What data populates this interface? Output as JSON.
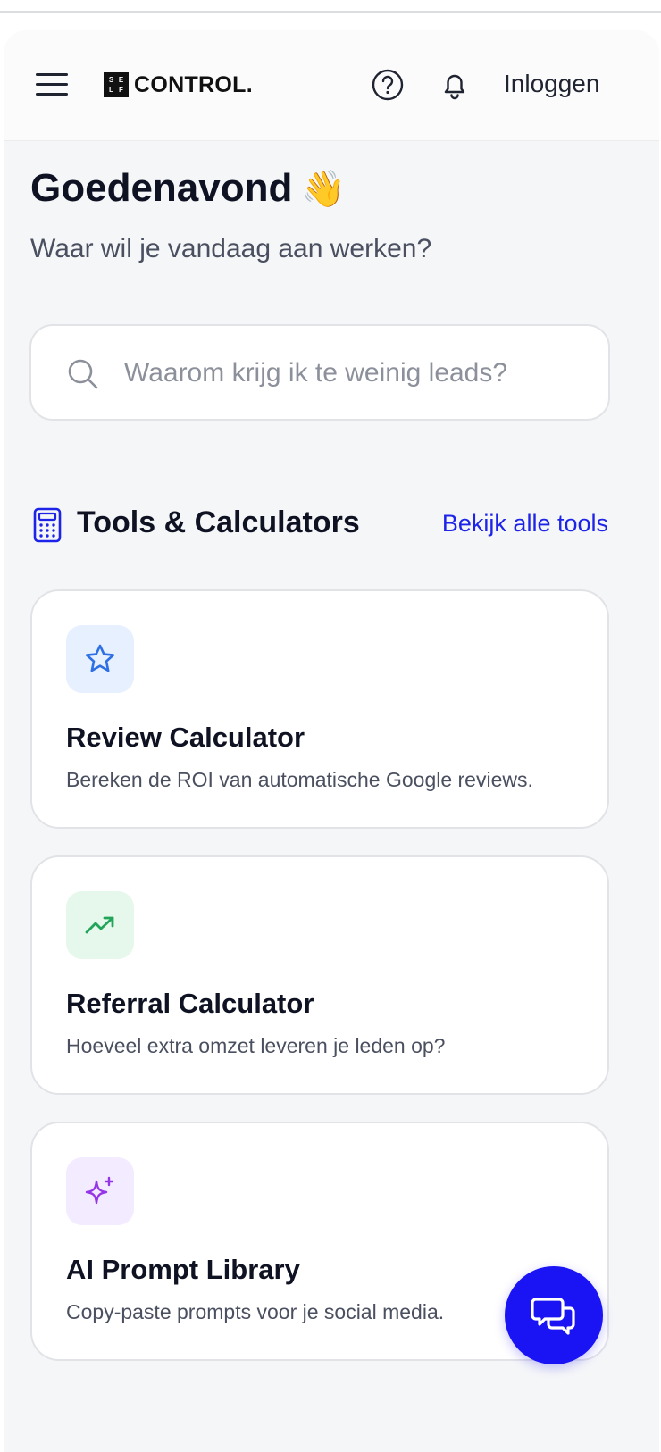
{
  "header": {
    "logo_letters": [
      "S",
      "E",
      "L",
      "F"
    ],
    "logo_text": "CONTROL.",
    "login_label": "Inloggen",
    "icons": [
      "menu-icon",
      "help-icon",
      "bell-icon"
    ]
  },
  "greeting": {
    "title": "Goedenavond",
    "emoji": "👋",
    "subtitle": "Waar wil je vandaag aan werken?"
  },
  "search": {
    "placeholder": "Waarom krijg ik te weinig leads?",
    "value": ""
  },
  "tools": {
    "section_title": "Tools & Calculators",
    "view_all_label": "Bekijk alle tools",
    "items": [
      {
        "title": "Review Calculator",
        "description": "Bereken de ROI van automatische Google reviews.",
        "icon": "star-icon",
        "icon_color": "#2f6fe4"
      },
      {
        "title": "Referral Calculator",
        "description": "Hoeveel extra omzet leveren je leden op?",
        "icon": "trending-up-icon",
        "icon_color": "#22a559"
      },
      {
        "title": "AI Prompt Library",
        "description": "Copy-paste prompts voor je social media.",
        "icon": "sparkles-icon",
        "icon_color": "#9436e8"
      }
    ]
  },
  "colors": {
    "accent": "#1d24e8",
    "chat_button": "#1a14f5"
  }
}
